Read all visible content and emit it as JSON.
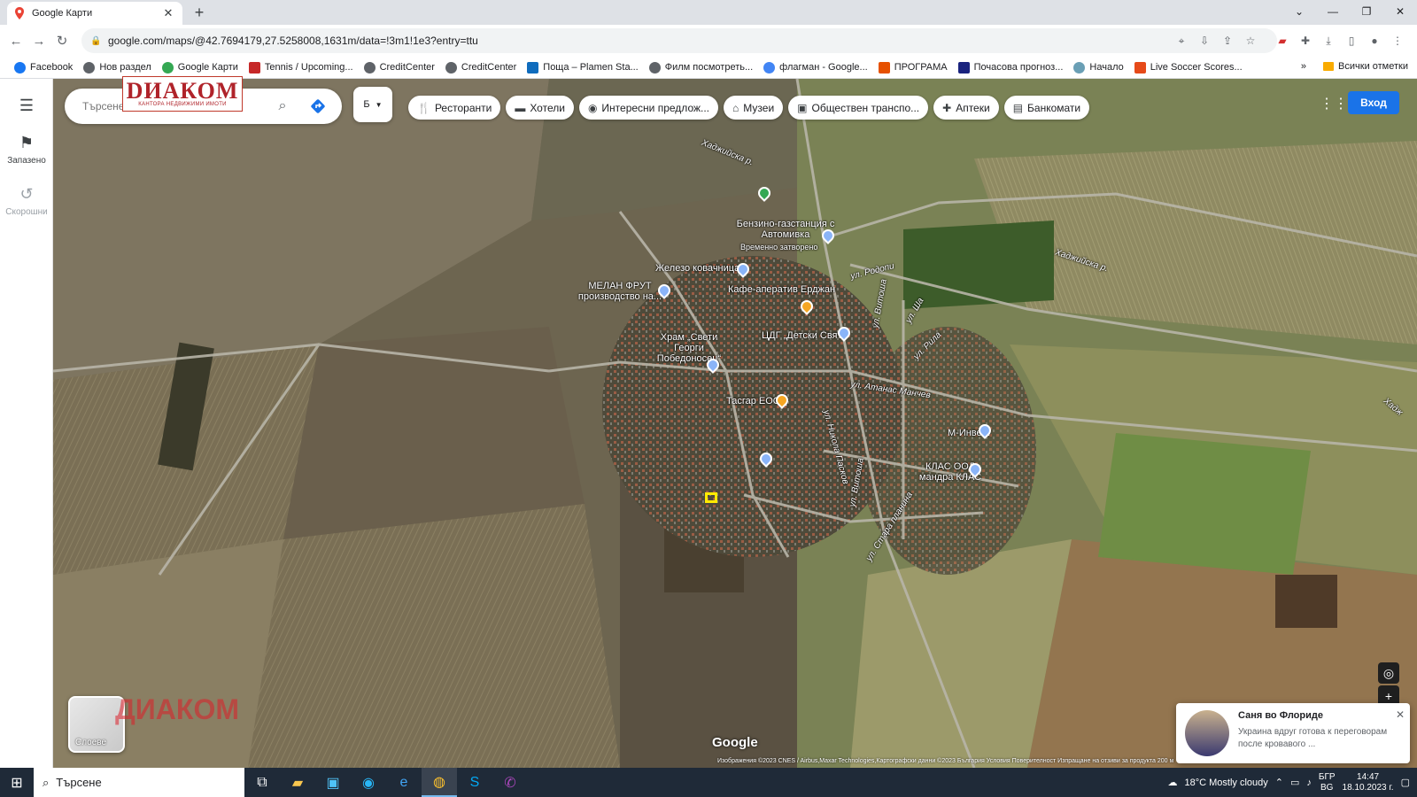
{
  "browser": {
    "tab_title": "Google Карти",
    "url": "google.com/maps/@42.7694179,27.5258008,1631m/data=!3m1!1e3?entry=ttu",
    "bookmarks": [
      {
        "label": "Facebook",
        "color": "#1877f2"
      },
      {
        "label": "Нов раздел",
        "color": "#5f6368"
      },
      {
        "label": "Google Карти",
        "color": "#34a853"
      },
      {
        "label": "Tennis / Upcoming...",
        "color": "#c62828"
      },
      {
        "label": "CreditCenter",
        "color": "#5f6368"
      },
      {
        "label": "CreditCenter",
        "color": "#5f6368"
      },
      {
        "label": "Поща – Plamen Sta...",
        "color": "#0f6cbd"
      },
      {
        "label": "Филм посмотреть...",
        "color": "#5f6368"
      },
      {
        "label": "флагман - Google...",
        "color": "#4285f4"
      },
      {
        "label": "ПРОГРАМА",
        "color": "#e65100"
      },
      {
        "label": "Почасова прогноз...",
        "color": "#1a237e"
      },
      {
        "label": "Начало",
        "color": "#6a9fb5"
      },
      {
        "label": "Live Soccer Scores...",
        "color": "#e64a19"
      }
    ],
    "all_bookmarks": "Всички отметки",
    "more_bookmarks": "»"
  },
  "rail": {
    "menu_icon": "hamburger-icon",
    "saved": "Запазено",
    "recent": "Скорошни"
  },
  "search": {
    "placeholder": "Търсене"
  },
  "logo": {
    "text": "DИАКОМ",
    "subtitle": "КАНТОРА НЕДВИЖИМИ ИМОТИ"
  },
  "chips": [
    {
      "label": "Ресторанти",
      "icon": "fork-knife-icon"
    },
    {
      "label": "Хотели",
      "icon": "bed-icon"
    },
    {
      "label": "Интересни предлож...",
      "icon": "camera-icon"
    },
    {
      "label": "Музеи",
      "icon": "museum-icon"
    },
    {
      "label": "Обществен транспо...",
      "icon": "bus-icon"
    },
    {
      "label": "Аптеки",
      "icon": "pharmacy-icon"
    },
    {
      "label": "Банкомати",
      "icon": "atm-icon"
    }
  ],
  "signin": "Вход",
  "map_labels": {
    "hadzhiyska_1": "Хаджийска р.",
    "hadzhiyska_2": "Хаджийска р.",
    "hadzhiyska_3": "Хадж",
    "gas": "Бензино-газстанция с Автомивка",
    "gas_note": "Временно затворено",
    "zhelezo": "Железо ковачница",
    "melan": "МЕЛАН ФРУТ производство на...",
    "kafe": "Кафе-аперaтив Ерджан",
    "hram": "Храм „Свети Георги Победоносец“",
    "cdg": "ЦДГ „Детски Свят“",
    "tasgar": "Тасгар ЕООД",
    "minvest": "М-Инвест",
    "klas": "КЛАС ООД мандра КЛАС",
    "ul_rodopi": "ул. Родопи",
    "ul_vitosha": "ул. Витоша",
    "ul_atanas": "ул. Атанас Манчев",
    "ul_nikola": "ул. Никола Пасков",
    "ul_vitosha2": "ул. Витоша",
    "ul_stara": "ул. Стара планина",
    "ul_sha": "ул. Ша",
    "ul_rila": "ул. Рила"
  },
  "layers_label": "Слоеве",
  "watermark": "ДИАКОМ",
  "google_mark": "Google",
  "attribution": "Изображения ©2023 CNES / Airbus,Maxar Technologies,Картографски данни ©2023   България   Условия   Поверителност   Изпращане на отзиви за продукта   200 м",
  "notification": {
    "title": "Саня во Флориде",
    "body": "Украина вдруг готова к переговорам после кровавого ..."
  },
  "taskbar": {
    "search_placeholder": "Търсене",
    "weather": "18°C  Mostly cloudy",
    "lang": "БГР",
    "region": "BG",
    "time": "14:47",
    "date": "18.10.2023 г."
  }
}
